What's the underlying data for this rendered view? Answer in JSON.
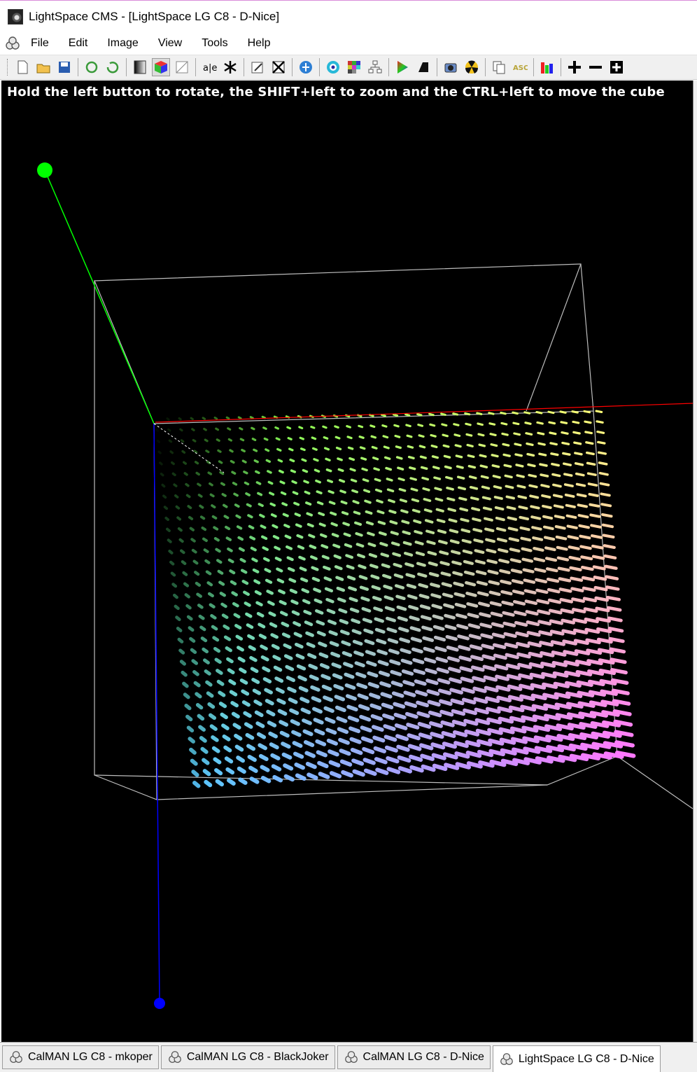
{
  "window": {
    "title": "LightSpace CMS - [LightSpace LG C8 - D-Nice]"
  },
  "menu": {
    "items": [
      "File",
      "Edit",
      "Image",
      "View",
      "Tools",
      "Help"
    ]
  },
  "toolbar": {
    "buttons": [
      "new-file-icon",
      "open-folder-icon",
      "save-disk-icon",
      "refresh-icon",
      "refresh-alt-icon",
      "gradient-strip-icon",
      "color-cube-icon",
      "blank-panel-icon",
      "text-tool-icon",
      "asterisk-icon",
      "edit-pencil-icon",
      "cross-grid-icon",
      "globe-icon",
      "target-icon",
      "color-checker-icon",
      "network-icon",
      "play-triangle-icon",
      "black-shape-icon",
      "camera-icon",
      "radiation-icon",
      "copy-pages-icon",
      "asc-label-icon",
      "rgb-bars-icon",
      "plus-icon",
      "minus-icon",
      "expand-icon"
    ]
  },
  "viewport": {
    "hint": "Hold the left button to rotate, the SHIFT+left to zoom and the CTRL+left to move the cube",
    "background": "#000000",
    "axis_colors": {
      "x": "#ff0000",
      "y": "#00ff00",
      "z": "#0000ff"
    }
  },
  "tabs": [
    {
      "label": "CalMAN LG C8 - mkoper",
      "active": false
    },
    {
      "label": "CalMAN LG C8 - BlackJoker",
      "active": false
    },
    {
      "label": "CalMAN LG C8 - D-Nice",
      "active": false
    },
    {
      "label": "LightSpace LG C8 - D-Nice",
      "active": true
    }
  ]
}
